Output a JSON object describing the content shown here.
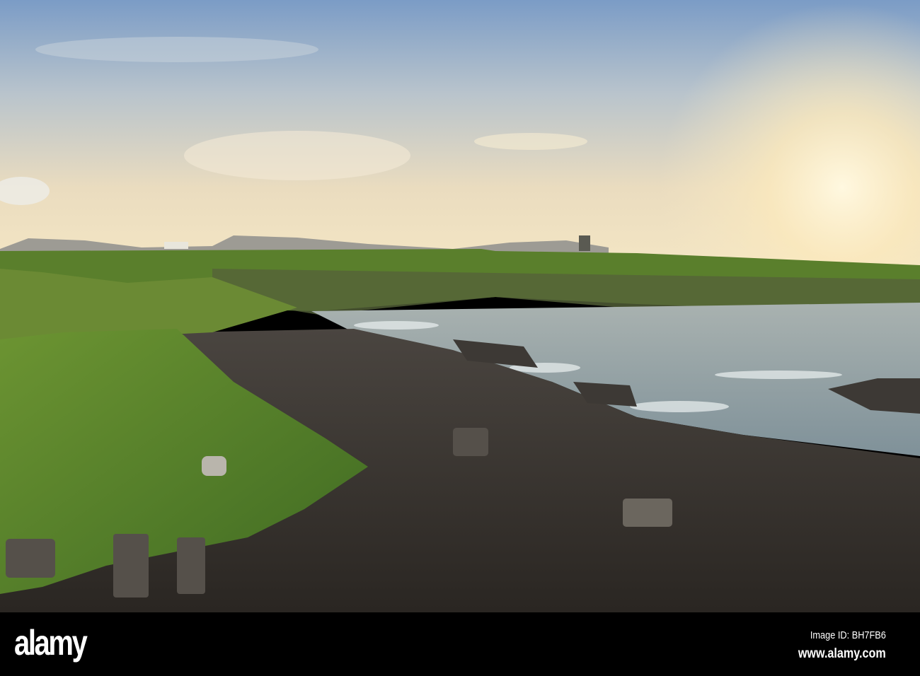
{
  "photo": {
    "subject": "coastal-landscape",
    "colors": {
      "sky_top": "#7b9cc6",
      "sky_horizon": "#f4e6c4",
      "sun": "#fff6dc",
      "grass": "#5d8a2c",
      "sea": "#8d9ca2",
      "rock": "#3b3630"
    }
  },
  "watermark": {
    "text": "alamy"
  },
  "footer": {
    "logo": "alamy",
    "image_id": "Image ID: BH7FB6",
    "website": "www.alamy.com"
  }
}
